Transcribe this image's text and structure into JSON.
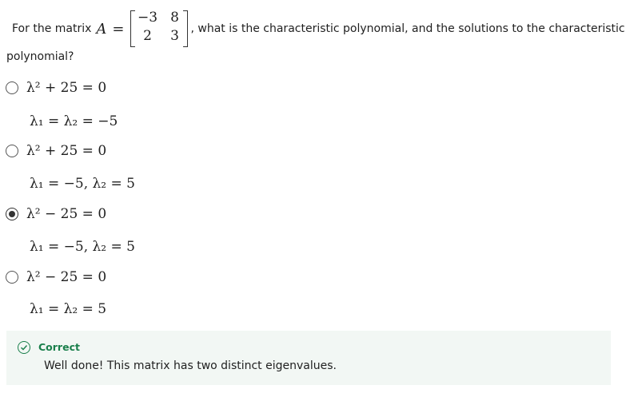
{
  "question": {
    "prefix": "For the matrix",
    "matrix_symbol": "A",
    "equals": "=",
    "matrix": [
      [
        "−3",
        "8"
      ],
      [
        "2",
        "3"
      ]
    ],
    "suffix": ", what is the characteristic polynomial, and the solutions to the characteristic",
    "continuation": "polynomial?"
  },
  "options": [
    {
      "equation": "λ² + 25 = 0",
      "solution": "λ₁ = λ₂ = −5",
      "selected": false
    },
    {
      "equation": "λ² + 25 = 0",
      "solution": "λ₁ = −5, λ₂ = 5",
      "selected": false
    },
    {
      "equation": "λ² − 25 = 0",
      "solution": "λ₁ = −5, λ₂ = 5",
      "selected": true
    },
    {
      "equation": "λ² − 25 = 0",
      "solution": "λ₁ = λ₂ = 5",
      "selected": false
    }
  ],
  "feedback": {
    "status": "Correct",
    "message": "Well done! This matrix has two distinct eigenvalues.",
    "icon": "check-circle-icon",
    "status_color": "#1a7f4b",
    "background": "#f2f7f4"
  }
}
